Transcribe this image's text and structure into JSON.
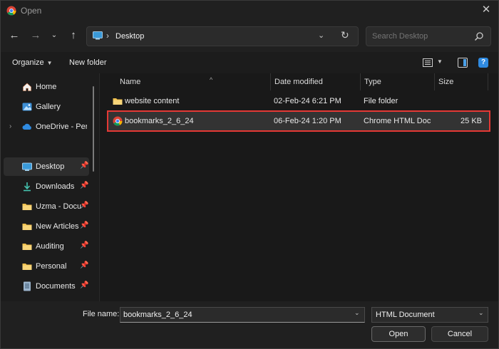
{
  "window": {
    "title": "Open"
  },
  "nav": {
    "address_location": "Desktop",
    "search_placeholder": "Search Desktop"
  },
  "toolbar": {
    "organize_label": "Organize",
    "new_folder_label": "New folder"
  },
  "sidebar": {
    "items": [
      {
        "label": "Home",
        "icon": "home-icon"
      },
      {
        "label": "Gallery",
        "icon": "gallery-icon"
      },
      {
        "label": "OneDrive - Perso",
        "icon": "cloud-icon"
      },
      {
        "label": "Desktop",
        "icon": "desktop-icon",
        "pinned": true,
        "active": true
      },
      {
        "label": "Downloads",
        "icon": "download-icon",
        "pinned": true
      },
      {
        "label": "Uzma - Docu",
        "icon": "folder-icon",
        "pinned": true
      },
      {
        "label": "New Articles",
        "icon": "folder-icon",
        "pinned": true
      },
      {
        "label": "Auditing",
        "icon": "folder-icon",
        "pinned": true
      },
      {
        "label": "Personal",
        "icon": "folder-icon",
        "pinned": true
      },
      {
        "label": "Documents",
        "icon": "document-icon",
        "pinned": true
      }
    ]
  },
  "filelist": {
    "columns": [
      "Name",
      "Date modified",
      "Type",
      "Size"
    ],
    "rows": [
      {
        "name": "website content",
        "date": "02-Feb-24 6:21 PM",
        "type": "File folder",
        "size": "",
        "icon": "folder-icon"
      },
      {
        "name": "bookmarks_2_6_24",
        "date": "06-Feb-24 1:20 PM",
        "type": "Chrome HTML Doc...",
        "size": "25 KB",
        "icon": "chrome-icon",
        "selected": true
      }
    ]
  },
  "bottom": {
    "filename_label": "File name:",
    "filename_value": "bookmarks_2_6_24",
    "filetype_selected": "HTML Document",
    "open_label": "Open",
    "cancel_label": "Cancel"
  },
  "colors": {
    "accent": "#2f8ae0",
    "highlight_border": "#e53935",
    "folder": "#f2c14e"
  }
}
